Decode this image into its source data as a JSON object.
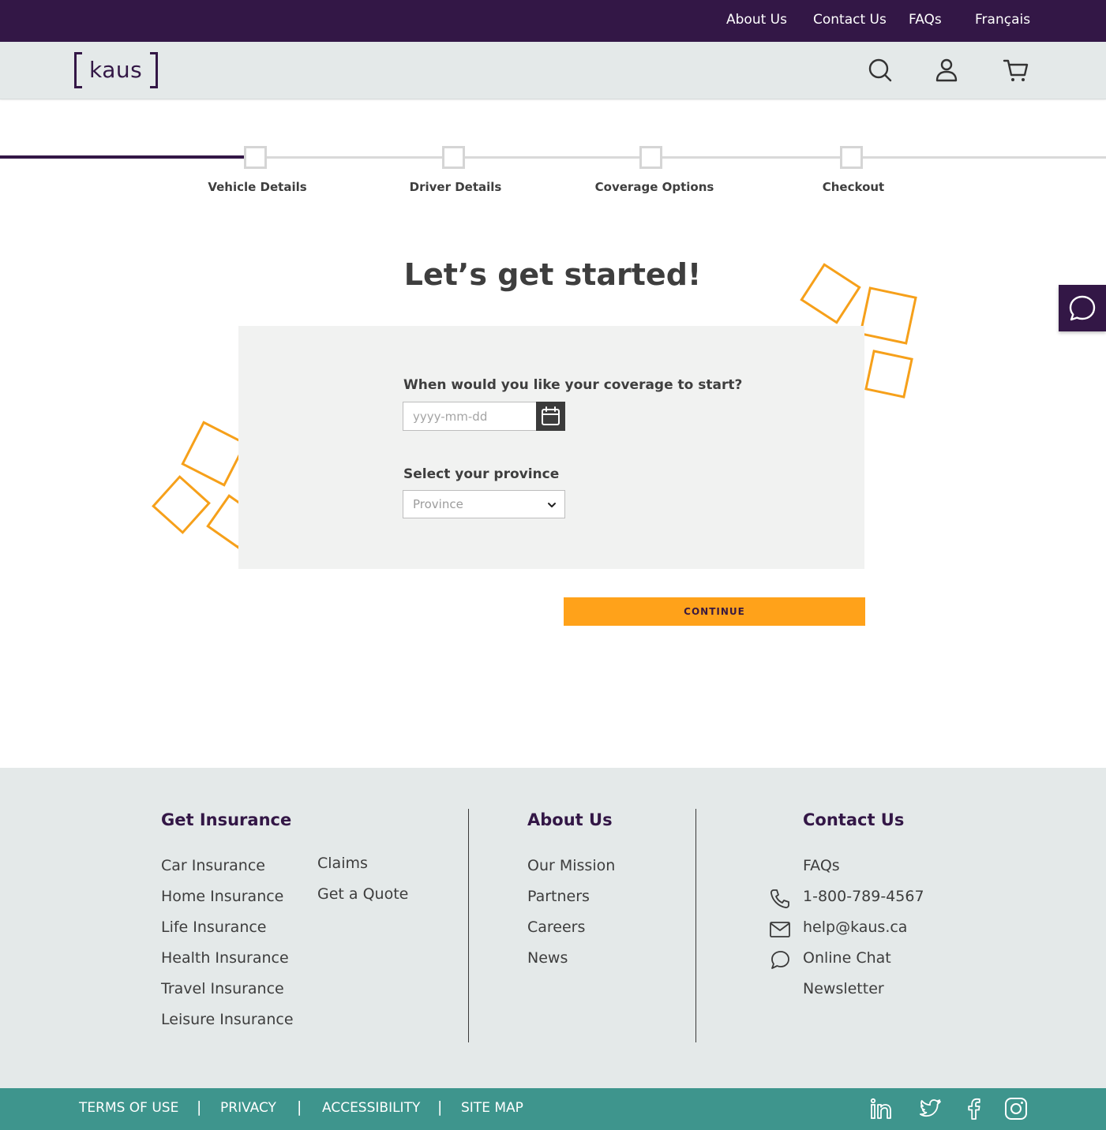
{
  "topnav": {
    "about": "About Us",
    "contact": "Contact Us",
    "faqs": "FAQs",
    "language": "Français"
  },
  "brand": {
    "logo_text": "kaus"
  },
  "header_icons": [
    "search-icon",
    "user-icon",
    "cart-icon"
  ],
  "stepper": {
    "steps": [
      "Vehicle Details",
      "Driver Details",
      "Coverage Options",
      "Checkout"
    ]
  },
  "main": {
    "title": "Let’s get started!",
    "coverage_label": "When would you like your coverage to start?",
    "date_placeholder": "yyyy-mm-dd",
    "province_label": "Select your province",
    "province_placeholder": "Province",
    "continue_label": "CONTINUE"
  },
  "footer": {
    "get_insurance": {
      "heading": "Get Insurance",
      "col1": [
        "Car Insurance",
        "Home Insurance",
        "Life Insurance",
        "Health Insurance",
        "Travel Insurance",
        "Leisure Insurance"
      ],
      "col2": [
        "Claims",
        "Get a Quote"
      ]
    },
    "about": {
      "heading": "About Us",
      "links": [
        "Our Mission",
        "Partners",
        "Careers",
        "News"
      ]
    },
    "contact": {
      "heading": "Contact Us",
      "faqs": "FAQs",
      "phone": "1-800-789-4567",
      "email": "help@kaus.ca",
      "chat": "Online Chat",
      "newsletter": "Newsletter"
    }
  },
  "legal": {
    "terms": "TERMS OF USE",
    "privacy": "PRIVACY",
    "accessibility": "ACCESSIBILITY",
    "sitemap": "SITE MAP",
    "separator": "|"
  },
  "social_icons": [
    "linkedin-icon",
    "twitter-icon",
    "facebook-icon",
    "instagram-icon"
  ],
  "colors": {
    "primary": "#331746",
    "accent": "#ffa21a",
    "header_bg": "#e4e9e9",
    "panel_bg": "#f1f2f1",
    "bottom_bar": "#3e958d"
  }
}
